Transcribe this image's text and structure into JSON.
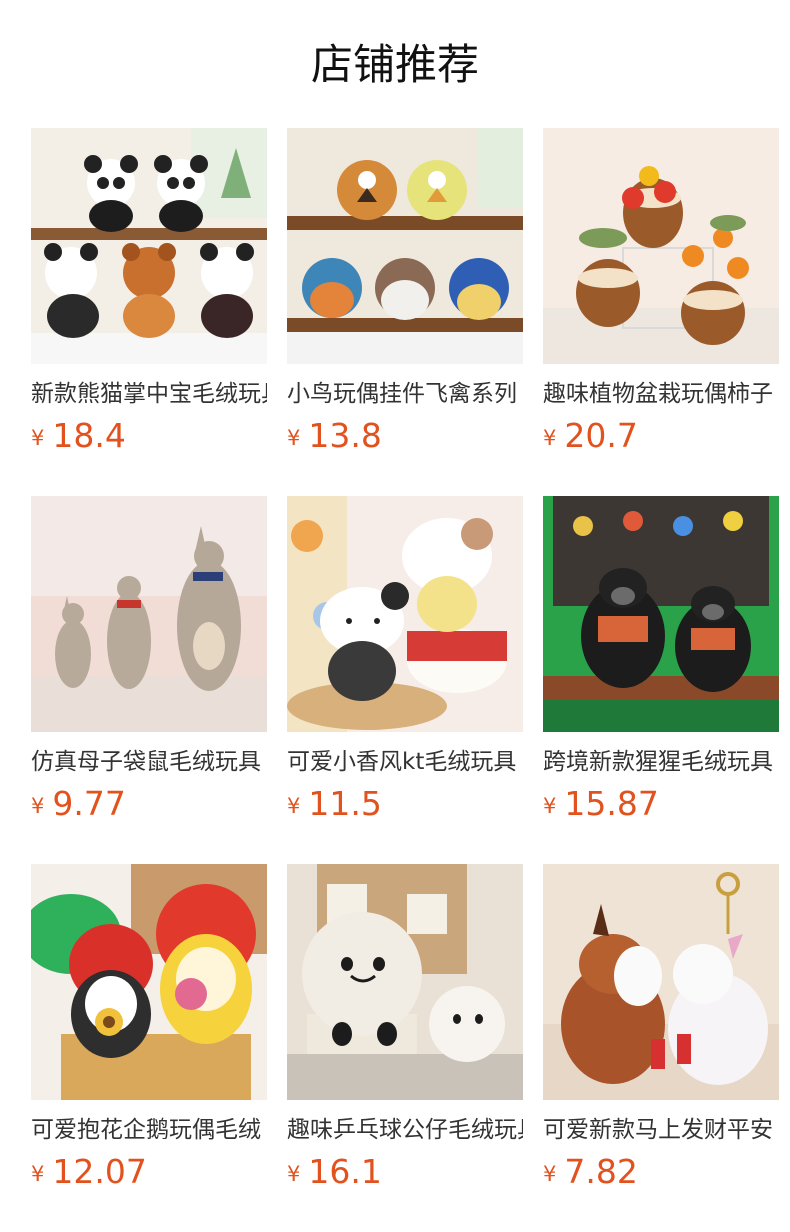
{
  "header": {
    "title": "店铺推荐"
  },
  "currency_symbol": "¥",
  "products": [
    {
      "name": "新款熊猫掌中宝毛绒玩具",
      "price": "18.4",
      "image": "pandas-and-red-panda-plush"
    },
    {
      "name": "小鸟玩偶挂件飞禽系列",
      "price": "13.8",
      "image": "bird-plush-on-shelf"
    },
    {
      "name": "趣味植物盆栽玩偶柿子",
      "price": "20.7",
      "image": "potted-fruit-tree-plush"
    },
    {
      "name": "仿真母子袋鼠毛绒玩具",
      "price": "9.77",
      "image": "kangaroo-mother-plush"
    },
    {
      "name": "可爱小香风kt毛绒玩具",
      "price": "11.5",
      "image": "hello-kitty-plush-cake"
    },
    {
      "name": "跨境新款猩猩毛绒玩具",
      "price": "15.87",
      "image": "gorilla-plush-bench"
    },
    {
      "name": "可爱抱花企鹅玩偶毛绒",
      "price": "12.07",
      "image": "strawberry-penguin-plush"
    },
    {
      "name": "趣味乒乓球公仔毛绒玩具",
      "price": "16.1",
      "image": "ping-pong-ball-plush"
    },
    {
      "name": "可爱新款马上发财平安",
      "price": "7.82",
      "image": "horse-keychain-plush"
    }
  ]
}
